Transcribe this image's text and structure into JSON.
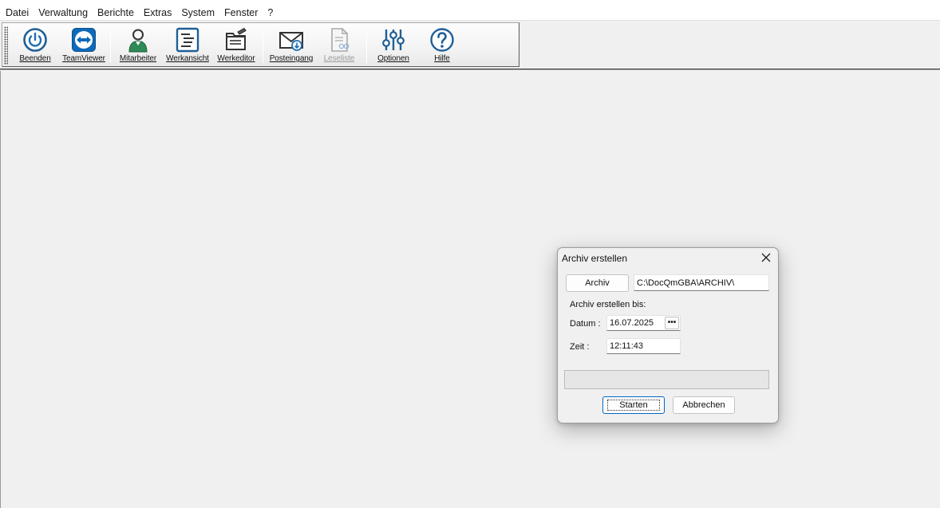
{
  "menu": [
    "Datei",
    "Verwaltung",
    "Berichte",
    "Extras",
    "System",
    "Fenster",
    "?"
  ],
  "toolbar": {
    "beenden": "Beenden",
    "teamviewer": "TeamViewer",
    "mitarbeiter": "Mitarbeiter",
    "werkansicht": "Werkansicht",
    "werkeditor": "Werkeditor",
    "posteingang": "Posteingang",
    "leseliste": "Leseliste",
    "optionen": "Optionen",
    "hilfe": "Hilfe"
  },
  "icons": {
    "beenden": "power-icon",
    "teamviewer": "teamviewer-icon",
    "mitarbeiter": "person-icon",
    "werkansicht": "document-list-icon",
    "werkeditor": "folder-pen-icon",
    "posteingang": "mail-inbox-icon",
    "leseliste": "reading-list-icon",
    "optionen": "sliders-icon",
    "hilfe": "help-icon"
  },
  "colors": {
    "accent_blue": "#1f6fb2",
    "teamviewer_blue": "#0e6ab8",
    "person_green": "#2e8b57",
    "progress_green": "#06b025"
  },
  "dialog": {
    "title": "Archiv erstellen",
    "archiv_button": "Archiv",
    "archiv_path": "C:\\DocQmGBA\\ARCHIV\\",
    "section_label": "Archiv erstellen bis:",
    "datum_label": "Datum :",
    "datum_value": "16.07.2025",
    "zeit_label": "Zeit :",
    "zeit_value": "12:11:43",
    "progress_percent": 0,
    "start_button": "Starten",
    "cancel_button": "Abbrechen"
  }
}
